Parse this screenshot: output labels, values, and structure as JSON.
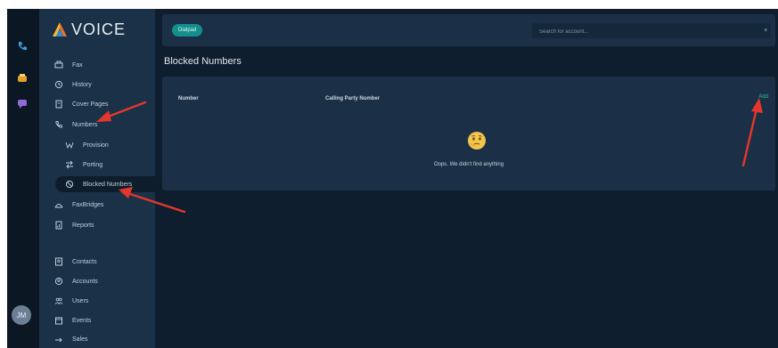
{
  "brand": {
    "name": "VOICE"
  },
  "rail": {
    "items": [
      {
        "icon": "phone-icon",
        "color": "#3aa0d8"
      },
      {
        "icon": "fax-app-icon",
        "color": "#e2a12a"
      },
      {
        "icon": "chat-app-icon",
        "color": "#8e6bd6"
      }
    ],
    "avatar_initials": "JM"
  },
  "sidebar": {
    "items": [
      {
        "label": "Fax",
        "icon": "fax-icon"
      },
      {
        "label": "History",
        "icon": "history-icon"
      },
      {
        "label": "Cover Pages",
        "icon": "document-icon"
      },
      {
        "label": "Numbers",
        "icon": "phone-icon"
      },
      {
        "label": "Provision",
        "icon": "provision-icon"
      },
      {
        "label": "Porting",
        "icon": "porting-icon"
      },
      {
        "label": "Blocked Numbers",
        "icon": "block-icon"
      },
      {
        "label": "FaxBridges",
        "icon": "faxbridge-icon"
      },
      {
        "label": "Reports",
        "icon": "reports-icon"
      },
      {
        "label": "Contacts",
        "icon": "contacts-icon"
      },
      {
        "label": "Accounts",
        "icon": "accounts-icon"
      },
      {
        "label": "Users",
        "icon": "users-icon"
      },
      {
        "label": "Events",
        "icon": "events-icon"
      },
      {
        "label": "Sales",
        "icon": "sales-icon"
      }
    ]
  },
  "topbar": {
    "dial_button": "Dialpad",
    "search_placeholder": "Search for account..."
  },
  "page": {
    "title": "Blocked Numbers"
  },
  "table": {
    "columns": [
      "Number",
      "Calling Party Number"
    ],
    "add_label": "Add",
    "empty_message": "Oops. We didn't find anything"
  },
  "colors": {
    "accent": "#158f8d",
    "add": "#2fbf96",
    "annotation_arrow": "#e5362d"
  }
}
